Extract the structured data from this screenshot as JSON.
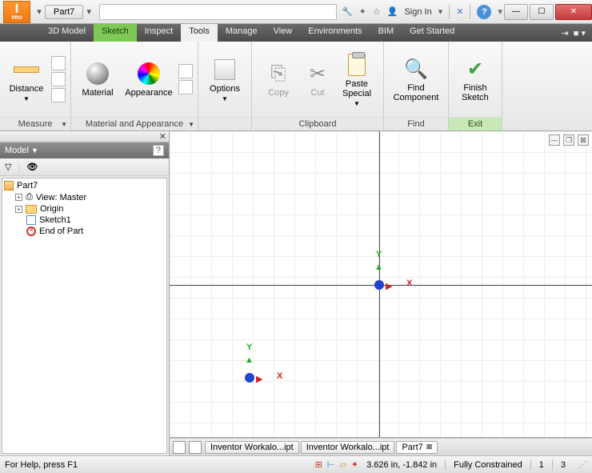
{
  "title": {
    "doc": "Part7"
  },
  "signin": "Sign In",
  "tabs": {
    "model3d": "3D Model",
    "sketch": "Sketch",
    "inspect": "Inspect",
    "tools": "Tools",
    "manage": "Manage",
    "view": "View",
    "env": "Environments",
    "bim": "BIM",
    "getstarted": "Get Started"
  },
  "ribbon": {
    "distance": "Distance",
    "material": "Material",
    "appearance": "Appearance",
    "options": "Options",
    "copy": "Copy",
    "cut": "Cut",
    "paste": "Paste Special",
    "find": "Find Component",
    "finish": "Finish Sketch",
    "grp_measure": "Measure",
    "grp_material": "Material and Appearance",
    "grp_clipboard": "Clipboard",
    "grp_find": "Find",
    "grp_exit": "Exit"
  },
  "browser": {
    "title": "Model",
    "root": "Part7",
    "view": "View: Master",
    "origin": "Origin",
    "sketch1": "Sketch1",
    "end": "End of Part"
  },
  "doctabs": {
    "t1": "Inventor Workalo...ipt",
    "t2": "Inventor Workalo...ipt",
    "t3": "Part7"
  },
  "status": {
    "help": "For Help, press F1",
    "coords": "3.626 in, -1.842 in",
    "constraint": "Fully Constrained",
    "dim1": "1",
    "dim2": "3"
  },
  "axis": {
    "x": "X",
    "y": "Y"
  }
}
